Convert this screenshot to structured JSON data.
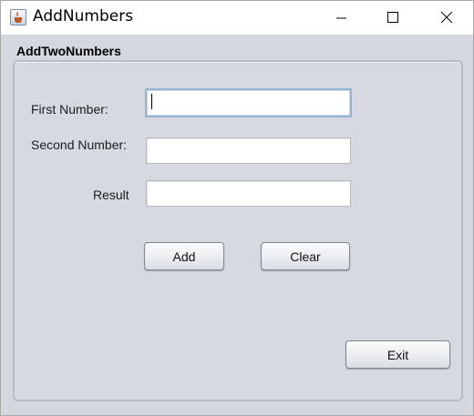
{
  "window": {
    "title": "AddNumbers",
    "icon": "java-cup-icon",
    "controls": [
      "minimize-icon",
      "maximize-icon",
      "close-icon"
    ]
  },
  "panel": {
    "title": "AddTwoNumbers"
  },
  "form": {
    "first_label": "First Number:",
    "first_value": "",
    "second_label": "Second Number:",
    "second_value": "",
    "result_label": "Result",
    "result_value": ""
  },
  "buttons": {
    "add": "Add",
    "clear": "Clear",
    "exit": "Exit"
  },
  "colors": {
    "content_background": "#d4d7de",
    "focus_border": "#96b4d2"
  }
}
